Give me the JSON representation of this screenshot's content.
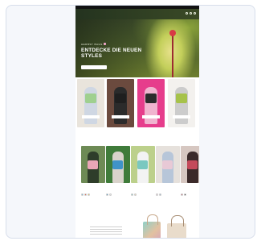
{
  "topbar": {
    "text": ""
  },
  "nav": {
    "menu": [
      "",
      "",
      "",
      "",
      ""
    ],
    "logo": "",
    "icons": [
      "search-icon",
      "account-icon",
      "cart-icon"
    ]
  },
  "hero": {
    "kicker": "HERBST BAGS",
    "headline": "ENTDECKE DIE NEUEN STYLES",
    "cta": ""
  },
  "categories": [
    {
      "label": "",
      "button": "",
      "bg": "#e9e4dc",
      "person": "#cfd7e3",
      "bag": "#9fd08f"
    },
    {
      "label": "",
      "button": "",
      "bg": "#6b4a3e",
      "person": "#2b2b2b",
      "bag": "#1f1f1f"
    },
    {
      "label": "",
      "button": "",
      "bg": "#e63d8c",
      "person": "#f0b4cf",
      "bag": "#2c2c2c"
    },
    {
      "label": "",
      "button": "",
      "bg": "#f3f1ee",
      "person": "#ccc",
      "bag": "#a6c24a"
    }
  ],
  "section": {
    "title": "",
    "subtitle": ""
  },
  "products": [
    {
      "name": "",
      "price": "",
      "bg": "#6d8a55",
      "fig": "#2e3d2a",
      "bag": "#e9a6b7",
      "swatches": [
        "#6cb8e0",
        "#e0503b",
        "#f4c542"
      ]
    },
    {
      "name": "",
      "price": "",
      "bg": "#3f7b3a",
      "fig": "#d9d3cb",
      "bag": "#3f93c8",
      "swatches": [
        "#3f93c8",
        "#e7e7e7"
      ]
    },
    {
      "name": "",
      "price": "",
      "bg": "#bcd08b",
      "fig": "#f3f3f3",
      "bag": "#7ac8c0",
      "swatches": [
        "#7ac8c0",
        "#ecd6b6"
      ]
    },
    {
      "name": "",
      "price": "",
      "bg": "#e6e1dc",
      "fig": "#b7c6d9",
      "bag": "#e8c9d6",
      "swatches": [
        "#e8c9d6",
        "#9bb5cf"
      ]
    },
    {
      "name": "",
      "price": "",
      "bg": "#d6c7c1",
      "fig": "#3b2a2a",
      "bag": "#c44a5a",
      "swatches": [
        "#c44a5a",
        "#2b2b2b"
      ]
    }
  ],
  "promo": {
    "title": "",
    "text_lines": 4
  }
}
